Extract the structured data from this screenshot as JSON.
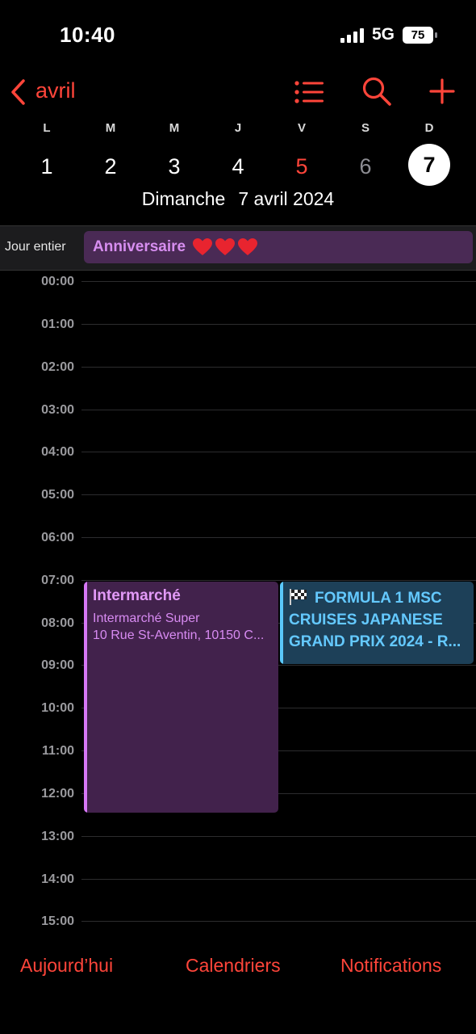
{
  "status_bar": {
    "time": "10:40",
    "network": "5G",
    "battery": "75",
    "signal_icon": "signal-bars-icon",
    "battery_icon": "battery-icon"
  },
  "header": {
    "back_label": "avril",
    "back_icon": "chevron-left-icon",
    "list_icon": "list-icon",
    "search_icon": "search-icon",
    "add_icon": "plus-icon",
    "accent_color": "#ff453a"
  },
  "week": {
    "days": [
      {
        "letter": "L",
        "number": "1"
      },
      {
        "letter": "M",
        "number": "2"
      },
      {
        "letter": "M",
        "number": "3"
      },
      {
        "letter": "J",
        "number": "4"
      },
      {
        "letter": "V",
        "number": "5"
      },
      {
        "letter": "S",
        "number": "6"
      },
      {
        "letter": "D",
        "number": "7"
      }
    ],
    "today_index": 4,
    "selected_index": 6,
    "selected_day_name": "Dimanche",
    "selected_date": "7 avril 2024"
  },
  "all_day": {
    "label": "Jour entier",
    "event_title": "Anniversaire",
    "event_icon": "heart-icon",
    "event_color": "#d78ef0"
  },
  "timeline": {
    "hours": [
      "00:00",
      "01:00",
      "02:00",
      "03:00",
      "04:00",
      "05:00",
      "06:00",
      "07:00",
      "08:00",
      "09:00",
      "10:00",
      "11:00",
      "12:00",
      "13:00",
      "14:00",
      "15:00"
    ]
  },
  "events": [
    {
      "title": "Intermarché",
      "line1": "Intermarché Super",
      "line2": "10 Rue St-Aventin, 10150 C...",
      "color": "#d677f5"
    },
    {
      "title": "FORMULA 1 MSC CRUISES JAPANESE GRAND PRIX 2024 - R...",
      "icon": "checkered-flag-icon",
      "color": "#5ac8fa"
    }
  ],
  "bottom_bar": {
    "today": "Aujourd’hui",
    "calendars": "Calendriers",
    "notifications": "Notifications"
  }
}
